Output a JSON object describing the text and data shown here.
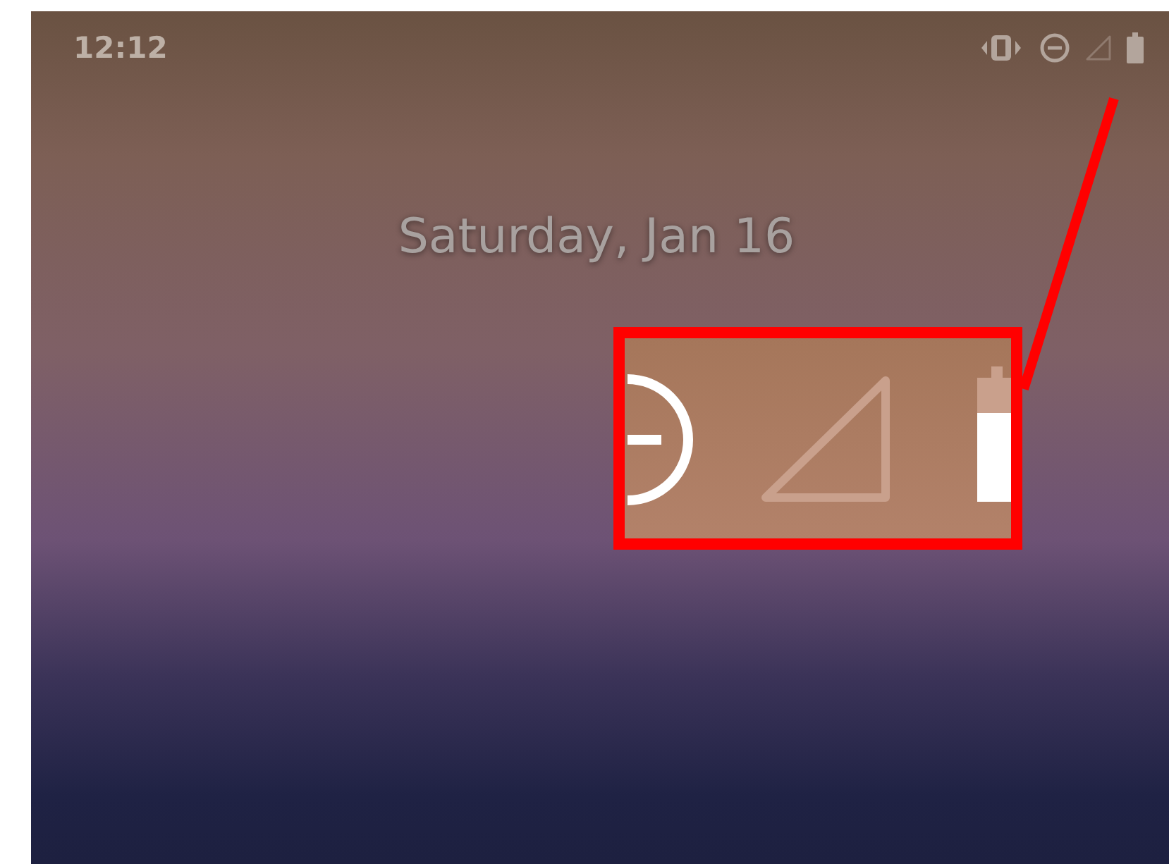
{
  "status_bar": {
    "time": "12:12"
  },
  "lock_screen": {
    "date": "Saturday, Jan 16"
  }
}
